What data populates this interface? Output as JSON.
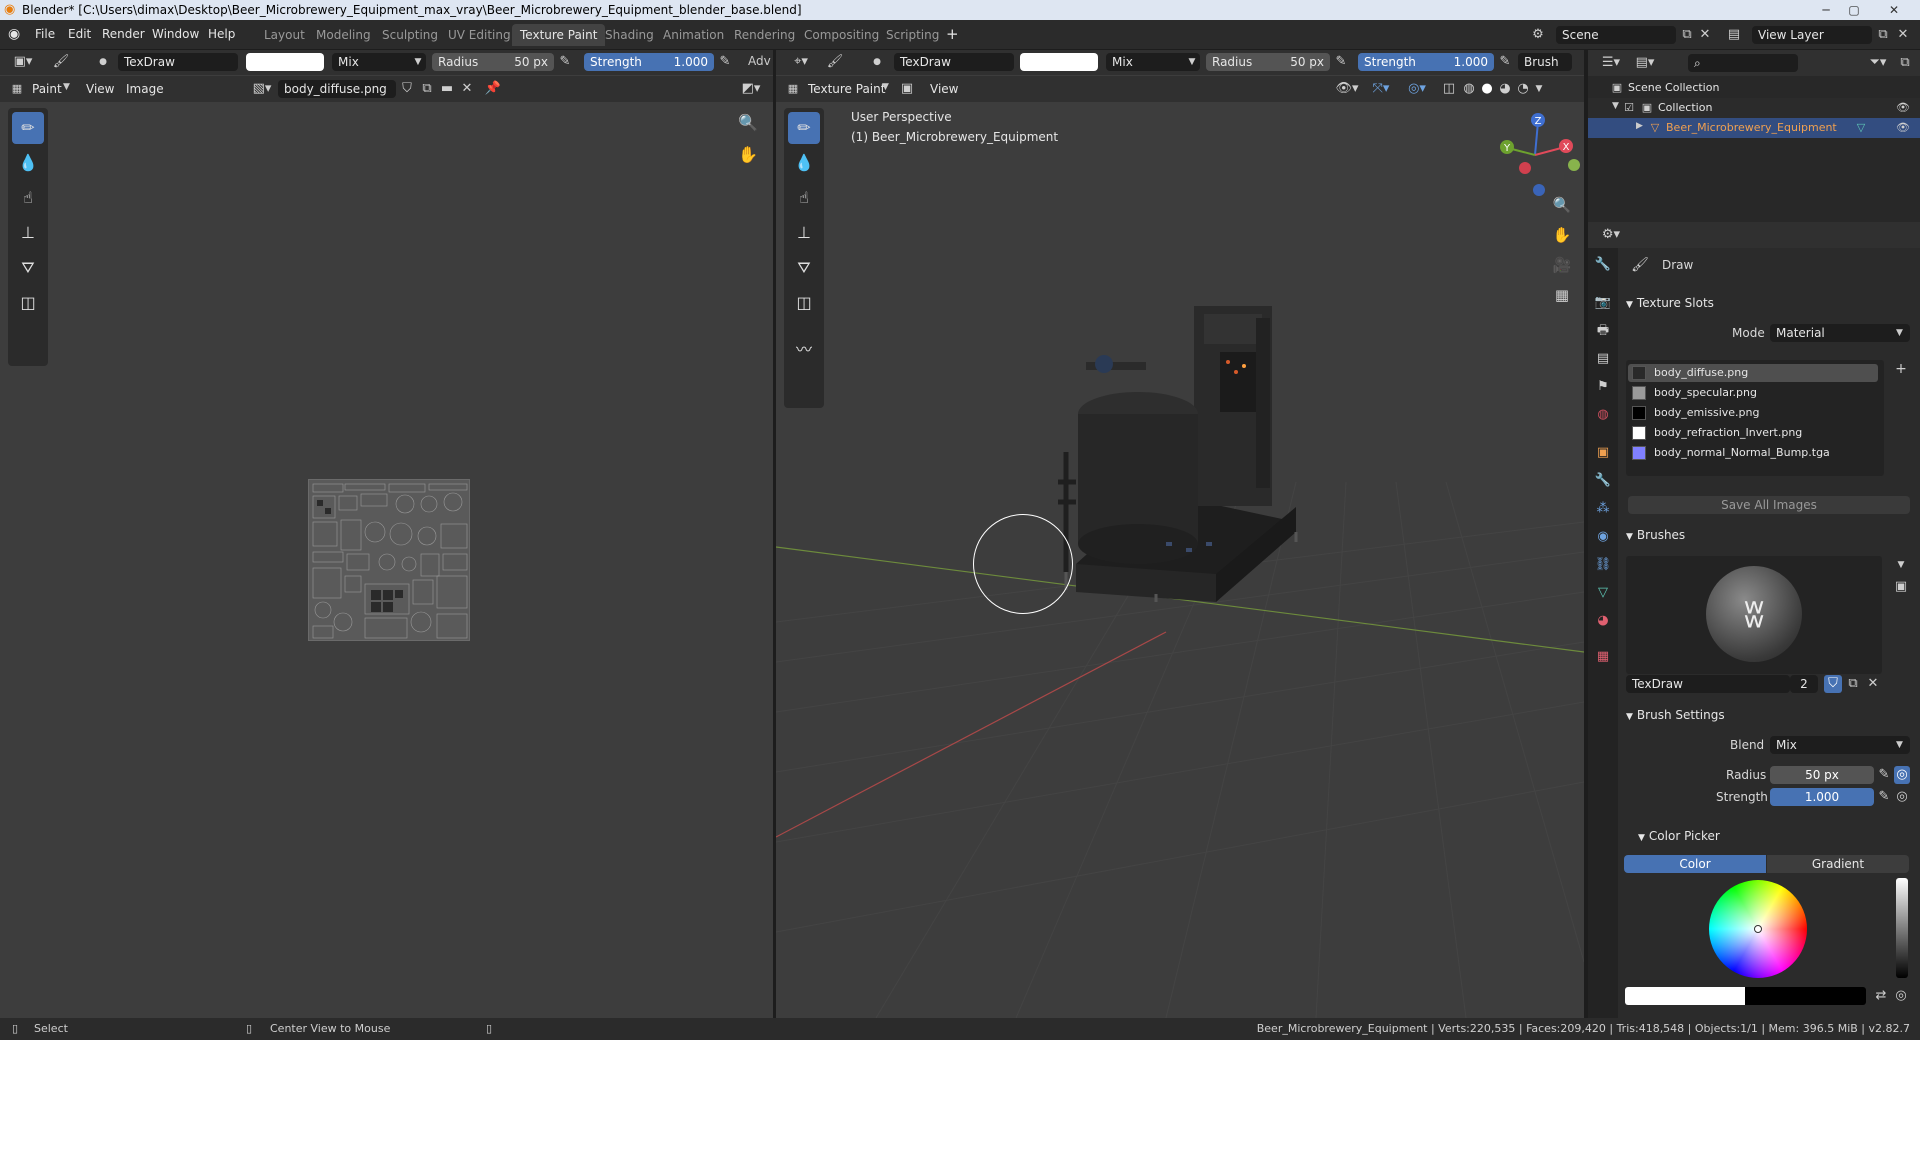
{
  "window": {
    "title": "Blender* [C:\\Users\\dimax\\Desktop\\Beer_Microbrewery_Equipment_max_vray\\Beer_Microbrewery_Equipment_blender_base.blend]"
  },
  "menu": [
    "File",
    "Edit",
    "Render",
    "Window",
    "Help"
  ],
  "workspaces": [
    "Layout",
    "Modeling",
    "Sculpting",
    "UV Editing",
    "Texture Paint",
    "Shading",
    "Animation",
    "Rendering",
    "Compositing",
    "Scripting"
  ],
  "active_workspace": "Texture Paint",
  "scene": {
    "label": "Scene",
    "view_layer": "View Layer"
  },
  "image_editor": {
    "brush_name": "TexDraw",
    "blend": "Mix",
    "radius_label": "Radius",
    "radius_value": "50 px",
    "strength_label": "Strength",
    "strength_value": "1.000",
    "adv": "Adv",
    "mode": "Paint",
    "menu_view": "View",
    "menu_image": "Image",
    "image_name": "body_diffuse.png"
  },
  "viewport": {
    "brush_name": "TexDraw",
    "blend": "Mix",
    "radius_label": "Radius",
    "radius_value": "50 px",
    "strength_label": "Strength",
    "strength_value": "1.000",
    "brush_menu": "Brush",
    "mode": "Texture Paint",
    "menu_view": "View",
    "perspective": "User Perspective",
    "object_label": "(1) Beer_Microbrewery_Equipment",
    "axes": {
      "x": "X",
      "y": "Y",
      "z": "Z"
    }
  },
  "outliner": {
    "scene_collection": "Scene Collection",
    "collection": "Collection",
    "object": "Beer_Microbrewery_Equipment"
  },
  "properties": {
    "tool_name": "Draw",
    "texture_slots": {
      "title": "Texture Slots",
      "mode_label": "Mode",
      "mode_value": "Material",
      "slots": [
        {
          "name": "body_diffuse.png",
          "color": "#2a2a2a"
        },
        {
          "name": "body_specular.png",
          "color": "#9a9a9a"
        },
        {
          "name": "body_emissive.png",
          "color": "#000000"
        },
        {
          "name": "body_refraction_Invert.png",
          "color": "#ffffff"
        },
        {
          "name": "body_normal_Normal_Bump.tga",
          "color": "#8080ff"
        }
      ],
      "save_all": "Save All Images"
    },
    "brushes": {
      "title": "Brushes",
      "brush_name": "TexDraw",
      "users": "2"
    },
    "brush_settings": {
      "title": "Brush Settings",
      "blend_label": "Blend",
      "blend_value": "Mix",
      "radius_label": "Radius",
      "radius_value": "50 px",
      "strength_label": "Strength",
      "strength_value": "1.000"
    },
    "color_picker": {
      "title": "Color Picker",
      "tab_color": "Color",
      "tab_gradient": "Gradient"
    }
  },
  "status_bar": {
    "select": "Select",
    "center_view": "Center View to Mouse",
    "stats": "Beer_Microbrewery_Equipment | Verts:220,535 | Faces:209,420 | Tris:418,548 | Objects:1/1 | Mem: 396.5 MiB | v2.82.7"
  }
}
